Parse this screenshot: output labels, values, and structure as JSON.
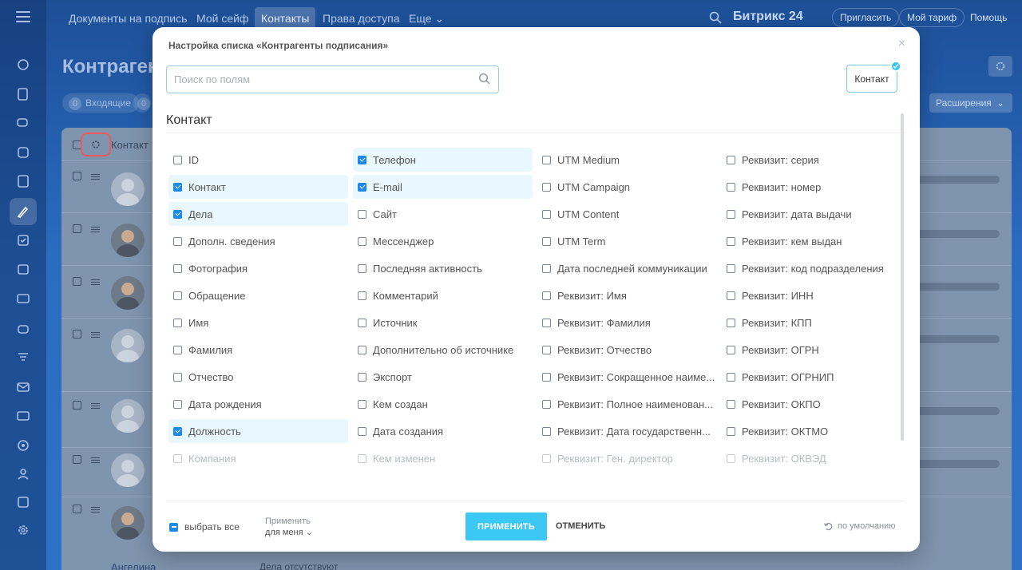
{
  "topnav": {
    "tabs": [
      "Документы на подпись",
      "Мой сейф",
      "Контакты",
      "Права доступа",
      "Еще ⌄"
    ],
    "active_tab": "Контакты",
    "brand": "Битрикс 24",
    "invite": "Пригласить",
    "tariff": "Мой тариф",
    "help": "Помощь"
  },
  "page": {
    "title": "Контрагенты",
    "counter_incoming_count": "0",
    "counter_incoming_label": "Входящие",
    "counter_second_count": "0",
    "extensions": "Расширения",
    "grid_header": "Контакт",
    "grid_header_right": "il",
    "last_row_name": "Ангелина",
    "last_row_deal": "Дела отсутствуют"
  },
  "modal": {
    "title": "Настройка списка «Контрагенты подписания»",
    "close": "×",
    "search_placeholder": "Поиск по полям",
    "section_chip": "Контакт",
    "section_title": "Контакт",
    "columns": [
      [
        {
          "label": "ID",
          "checked": false
        },
        {
          "label": "Контакт",
          "checked": true
        },
        {
          "label": "Дела",
          "checked": true
        },
        {
          "label": "Дополн. сведения",
          "checked": false
        },
        {
          "label": "Фотография",
          "checked": false
        },
        {
          "label": "Обращение",
          "checked": false
        },
        {
          "label": "Имя",
          "checked": false
        },
        {
          "label": "Фамилия",
          "checked": false
        },
        {
          "label": "Отчество",
          "checked": false
        },
        {
          "label": "Дата рождения",
          "checked": false
        },
        {
          "label": "Должность",
          "checked": true
        },
        {
          "label": "Компания",
          "checked": false,
          "dim": true
        }
      ],
      [
        {
          "label": "Телефон",
          "checked": true
        },
        {
          "label": "E-mail",
          "checked": true
        },
        {
          "label": "Сайт",
          "checked": false
        },
        {
          "label": "Мессенджер",
          "checked": false
        },
        {
          "label": "Последняя активность",
          "checked": false
        },
        {
          "label": "Комментарий",
          "checked": false
        },
        {
          "label": "Источник",
          "checked": false
        },
        {
          "label": "Дополнительно об источнике",
          "checked": false
        },
        {
          "label": "Экспорт",
          "checked": false
        },
        {
          "label": "Кем создан",
          "checked": false
        },
        {
          "label": "Дата создания",
          "checked": false
        },
        {
          "label": "Кем изменен",
          "checked": false,
          "dim": true
        }
      ],
      [
        {
          "label": "UTM Medium",
          "checked": false
        },
        {
          "label": "UTM Campaign",
          "checked": false
        },
        {
          "label": "UTM Content",
          "checked": false
        },
        {
          "label": "UTM Term",
          "checked": false
        },
        {
          "label": "Дата последней коммуникации",
          "checked": false
        },
        {
          "label": "Реквизит: Имя",
          "checked": false
        },
        {
          "label": "Реквизит: Фамилия",
          "checked": false
        },
        {
          "label": "Реквизит: Отчество",
          "checked": false
        },
        {
          "label": "Реквизит: Сокращенное наиме...",
          "checked": false
        },
        {
          "label": "Реквизит: Полное наименован...",
          "checked": false
        },
        {
          "label": "Реквизит: Дата государственн...",
          "checked": false
        },
        {
          "label": "Реквизит: Ген. директор",
          "checked": false,
          "dim": true
        }
      ],
      [
        {
          "label": "Реквизит: серия",
          "checked": false
        },
        {
          "label": "Реквизит: номер",
          "checked": false
        },
        {
          "label": "Реквизит: дата выдачи",
          "checked": false
        },
        {
          "label": "Реквизит: кем выдан",
          "checked": false
        },
        {
          "label": "Реквизит: код подразделения",
          "checked": false
        },
        {
          "label": "Реквизит: ИНН",
          "checked": false
        },
        {
          "label": "Реквизит: КПП",
          "checked": false
        },
        {
          "label": "Реквизит: ОГРН",
          "checked": false
        },
        {
          "label": "Реквизит: ОГРНИП",
          "checked": false
        },
        {
          "label": "Реквизит: ОКПО",
          "checked": false
        },
        {
          "label": "Реквизит: ОКТМО",
          "checked": false
        },
        {
          "label": "Реквизит: ОКВЭД",
          "checked": false,
          "dim": true
        }
      ]
    ],
    "select_all": "выбрать все",
    "apply_for_label": "Применить",
    "apply_for_value": "для меня ⌄",
    "apply_button": "ПРИМЕНИТЬ",
    "cancel_button": "ОТМЕНИТЬ",
    "reset": "по умолчанию"
  },
  "colors": {
    "accent": "#3bc8f5",
    "checkbox": "#1e88e5",
    "highlight_row": "#e9f8fe",
    "gear_highlight": "#f05a5a"
  }
}
